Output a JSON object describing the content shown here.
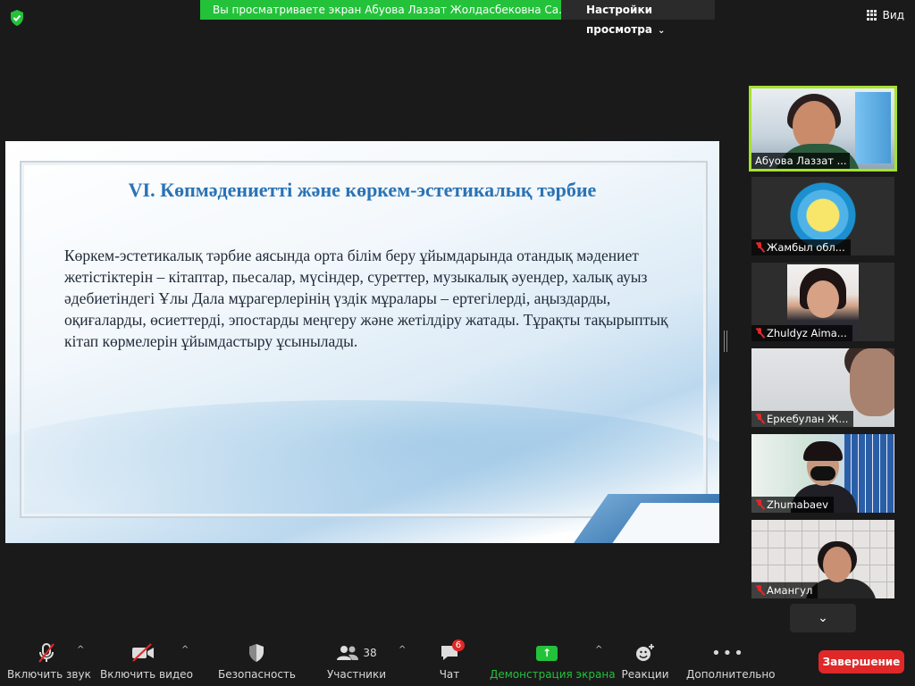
{
  "top": {
    "banner_text": "Вы просматриваете экран Абуова Лаззат Жолдасбековна Са...",
    "view_options_label": "Настройки просмотра",
    "view_button_label": "Вид"
  },
  "slide": {
    "title": "VI. Көпмәдениетті және көркем-эстетикалық тәрбие",
    "body": "Көркем-эстетикалық тәрбие аясында орта білім беру ұйымдарында отандық мәдениет жетістіктерін – кітаптар, пьесалар, мүсіндер, суреттер, музыкалық әуендер, халық ауыз әдебиетіндегі Ұлы Дала мұрагерлерінің үздік мұралары – ертегілерді, аңыздарды, оқиғаларды, өсиеттерді, эпостарды меңгеру және жетілдіру жатады. Тұрақты тақырыптық кітап көрмелерін ұйымдастыру ұсынылады."
  },
  "participants": [
    {
      "name": "Абуова Лаззат ...",
      "muted": false,
      "active": true
    },
    {
      "name": "Жамбыл обл...",
      "muted": true
    },
    {
      "name": "Zhuldyz Aima...",
      "muted": true
    },
    {
      "name": "Еркебулан Ж...",
      "muted": true
    },
    {
      "name": "Zhumabaev",
      "muted": true
    },
    {
      "name": "Амангул",
      "muted": true
    }
  ],
  "toolbar": {
    "mute_label": "Включить звук",
    "video_label": "Включить видео",
    "security_label": "Безопасность",
    "participants_label": "Участники",
    "participants_count": "38",
    "chat_label": "Чат",
    "chat_badge": "6",
    "share_label": "Демонстрация экрана",
    "reactions_label": "Реакции",
    "more_label": "Дополнительно",
    "end_label": "Завершение"
  },
  "colors": {
    "banner_green": "#23c23a",
    "active_border": "#a6e22e",
    "end_red": "#e02828",
    "slide_title_blue": "#2a73b6"
  }
}
